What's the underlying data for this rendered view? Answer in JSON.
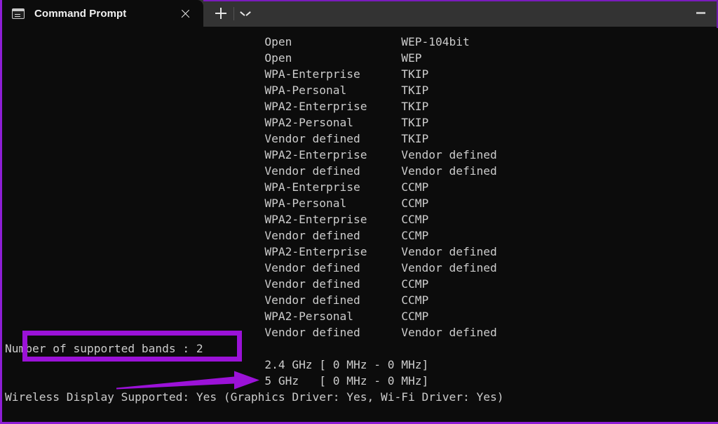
{
  "window": {
    "app_name": "Command Prompt",
    "accent_color": "#8e1ed6",
    "background_color": "#0c0c0c",
    "titlebar_color": "#333333",
    "text_color": "#cccccc"
  },
  "titlebar": {
    "tab_label": "Command Prompt",
    "tab_icon": "console-icon",
    "close_icon": "close-icon",
    "new_tab_icon": "plus-icon",
    "dropdown_icon": "chevron-down-icon",
    "minimize_icon": "minimize-icon"
  },
  "console": {
    "auth_encryption_rows": [
      {
        "auth": "Open",
        "encryption": "WEP-104bit"
      },
      {
        "auth": "Open",
        "encryption": "WEP"
      },
      {
        "auth": "WPA-Enterprise",
        "encryption": "TKIP"
      },
      {
        "auth": "WPA-Personal",
        "encryption": "TKIP"
      },
      {
        "auth": "WPA2-Enterprise",
        "encryption": "TKIP"
      },
      {
        "auth": "WPA2-Personal",
        "encryption": "TKIP"
      },
      {
        "auth": "Vendor defined",
        "encryption": "TKIP"
      },
      {
        "auth": "WPA2-Enterprise",
        "encryption": "Vendor defined"
      },
      {
        "auth": "Vendor defined",
        "encryption": "Vendor defined"
      },
      {
        "auth": "WPA-Enterprise",
        "encryption": "CCMP"
      },
      {
        "auth": "WPA-Personal",
        "encryption": "CCMP"
      },
      {
        "auth": "WPA2-Enterprise",
        "encryption": "CCMP"
      },
      {
        "auth": "Vendor defined",
        "encryption": "CCMP"
      },
      {
        "auth": "WPA2-Enterprise",
        "encryption": "Vendor defined"
      },
      {
        "auth": "Vendor defined",
        "encryption": "Vendor defined"
      },
      {
        "auth": "Vendor defined",
        "encryption": "CCMP"
      },
      {
        "auth": "Vendor defined",
        "encryption": "CCMP"
      },
      {
        "auth": "WPA2-Personal",
        "encryption": "CCMP"
      },
      {
        "auth": "Vendor defined",
        "encryption": "Vendor defined"
      }
    ],
    "bands_label": "Number of supported bands",
    "bands_separator": " : ",
    "bands_value": "2",
    "band_lines": [
      "2.4 GHz [ 0 MHz - 0 MHz]",
      "5 GHz   [ 0 MHz - 0 MHz]"
    ],
    "wireless_display_line": "Wireless Display Supported: Yes (Graphics Driver: Yes, Wi-Fi Driver: Yes)"
  },
  "annotations": {
    "highlight_box_target": "Number of supported bands",
    "arrow_target": "5 GHz   [ 0 MHz - 0 MHz]",
    "annotation_color": "#9b12d8"
  }
}
